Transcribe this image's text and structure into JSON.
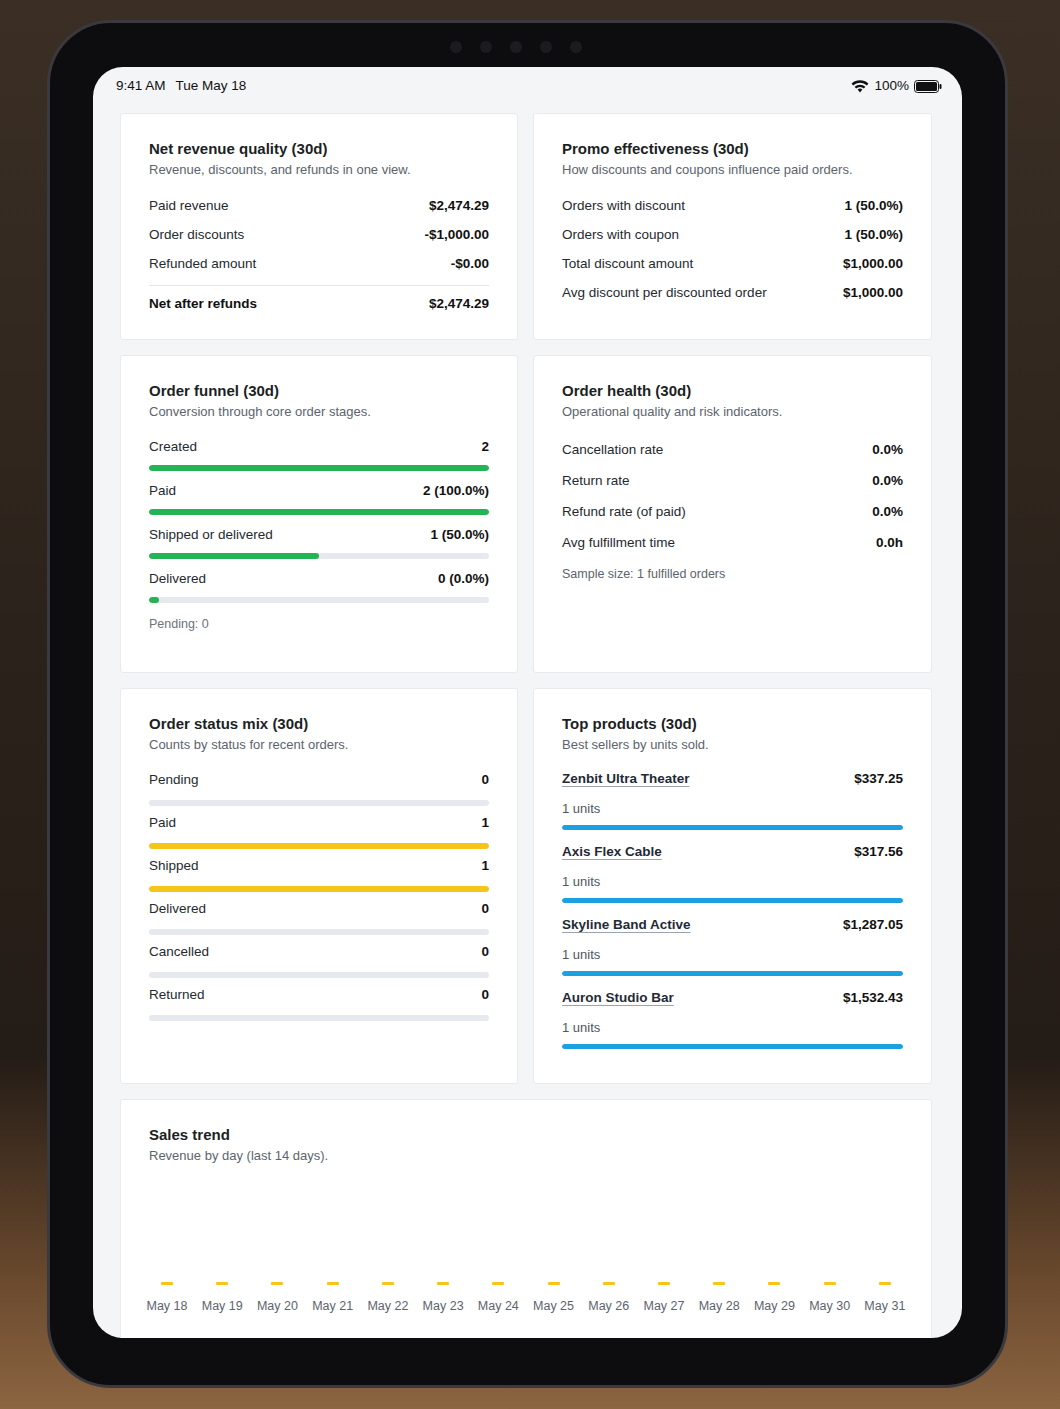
{
  "status_bar": {
    "time": "9:41 AM",
    "date": "Tue May 18",
    "battery": "100%"
  },
  "revenue_quality": {
    "title": "Net revenue quality (30d)",
    "subtitle": "Revenue, discounts, and refunds in one view.",
    "rows": [
      {
        "label": "Paid revenue",
        "value": "$2,474.29"
      },
      {
        "label": "Order discounts",
        "value": "-$1,000.00"
      },
      {
        "label": "Refunded amount",
        "value": "-$0.00"
      }
    ],
    "total": {
      "label": "Net after refunds",
      "value": "$2,474.29"
    }
  },
  "promo": {
    "title": "Promo effectiveness (30d)",
    "subtitle": "How discounts and coupons influence paid orders.",
    "rows": [
      {
        "label": "Orders with discount",
        "value": "1 (50.0%)"
      },
      {
        "label": "Orders with coupon",
        "value": "1 (50.0%)"
      },
      {
        "label": "Total discount amount",
        "value": "$1,000.00"
      },
      {
        "label": "Avg discount per discounted order",
        "value": "$1,000.00"
      }
    ]
  },
  "funnel": {
    "title": "Order funnel (30d)",
    "subtitle": "Conversion through core order stages.",
    "stages": [
      {
        "label": "Created",
        "value": "2",
        "level": 1
      },
      {
        "label": "Paid",
        "value": "2 (100.0%)",
        "level": 1
      },
      {
        "label": "Shipped or delivered",
        "value": "1 (50.0%)",
        "level": 0.5
      },
      {
        "label": "Delivered",
        "value": "0 (0.0%)",
        "level": 0.03
      }
    ],
    "pending": "Pending: 0"
  },
  "health": {
    "title": "Order health (30d)",
    "subtitle": "Operational quality and risk indicators.",
    "rows": [
      {
        "label": "Cancellation rate",
        "value": "0.0%"
      },
      {
        "label": "Return rate",
        "value": "0.0%"
      },
      {
        "label": "Refund rate (of paid)",
        "value": "0.0%"
      },
      {
        "label": "Avg fulfillment time",
        "value": "0.0h"
      }
    ],
    "sample": "Sample size: 1 fulfilled orders"
  },
  "status_mix": {
    "title": "Order status mix (30d)",
    "subtitle": "Counts by status for recent orders.",
    "items": [
      {
        "label": "Pending",
        "value": "0",
        "level": 0
      },
      {
        "label": "Paid",
        "value": "1",
        "level": 1
      },
      {
        "label": "Shipped",
        "value": "1",
        "level": 1
      },
      {
        "label": "Delivered",
        "value": "0",
        "level": 0
      },
      {
        "label": "Cancelled",
        "value": "0",
        "level": 0
      },
      {
        "label": "Returned",
        "value": "0",
        "level": 0
      }
    ]
  },
  "top_products": {
    "title": "Top products (30d)",
    "subtitle": "Best sellers by units sold.",
    "items": [
      {
        "name": "Zenbit Ultra Theater",
        "revenue": "$337.25",
        "units": "1 units",
        "level": 1
      },
      {
        "name": "Axis Flex Cable",
        "revenue": "$317.56",
        "units": "1 units",
        "level": 1
      },
      {
        "name": "Skyline Band Active",
        "revenue": "$1,287.05",
        "units": "1 units",
        "level": 1
      },
      {
        "name": "Auron Studio Bar",
        "revenue": "$1,532.43",
        "units": "1 units",
        "level": 1
      }
    ]
  },
  "sales_trend": {
    "title": "Sales trend",
    "subtitle": "Revenue by day (last 14 days).",
    "days": [
      "May 18",
      "May 19",
      "May 20",
      "May 21",
      "May 22",
      "May 23",
      "May 24",
      "May 25",
      "May 26",
      "May 27",
      "May 28",
      "May 29",
      "May 30",
      "May 31"
    ],
    "values": [
      0,
      0,
      0,
      0,
      0,
      0,
      0,
      0,
      0,
      0,
      0,
      0,
      0,
      0
    ]
  }
}
